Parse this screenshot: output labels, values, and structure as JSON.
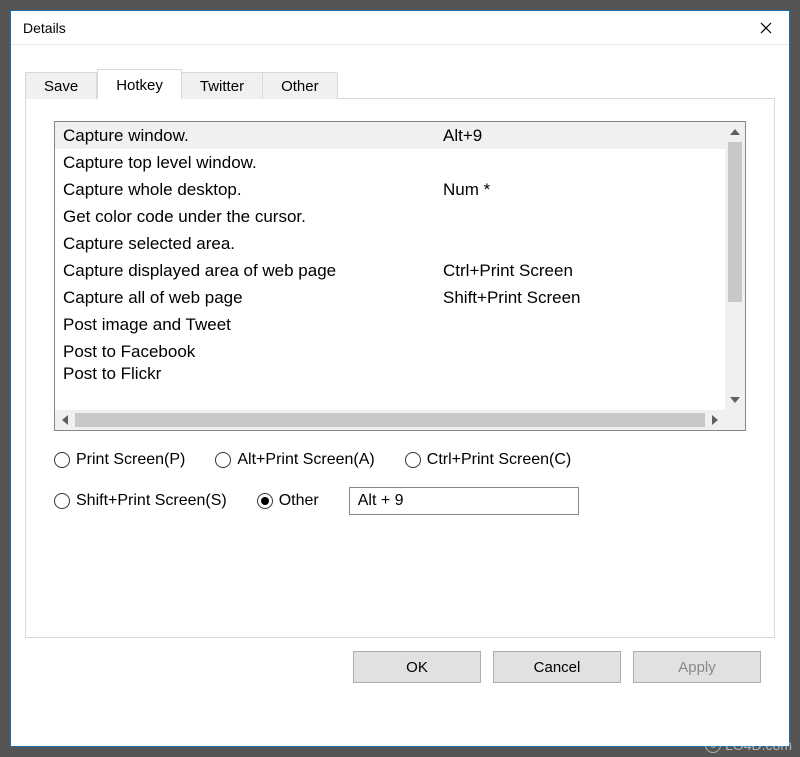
{
  "window": {
    "title": "Details"
  },
  "tabs": [
    "Save",
    "Hotkey",
    "Twitter",
    "Other"
  ],
  "active_tab_index": 1,
  "hotkey_list": [
    {
      "action": "Capture window.",
      "key": "Alt+9",
      "selected": true
    },
    {
      "action": "Capture top level window.",
      "key": ""
    },
    {
      "action": "Capture whole desktop.",
      "key": "Num *"
    },
    {
      "action": "Get color code under the cursor.",
      "key": ""
    },
    {
      "action": "Capture selected area.",
      "key": ""
    },
    {
      "action": "Capture displayed area of web page",
      "key": "Ctrl+Print Screen"
    },
    {
      "action": "Capture all of web page",
      "key": "Shift+Print Screen"
    },
    {
      "action": "Post image and Tweet",
      "key": ""
    },
    {
      "action": "Post to Facebook",
      "key": ""
    },
    {
      "action": "Post to Flickr",
      "key": ""
    }
  ],
  "radios": {
    "print_screen": "Print Screen(P)",
    "alt_print_screen": "Alt+Print Screen(A)",
    "ctrl_print_screen": "Ctrl+Print Screen(C)",
    "shift_print_screen": "Shift+Print Screen(S)",
    "other": "Other",
    "selected": "other"
  },
  "hotkey_input": {
    "value": "Alt + 9"
  },
  "buttons": {
    "ok": "OK",
    "cancel": "Cancel",
    "apply": "Apply"
  },
  "watermark": "LO4D.com"
}
